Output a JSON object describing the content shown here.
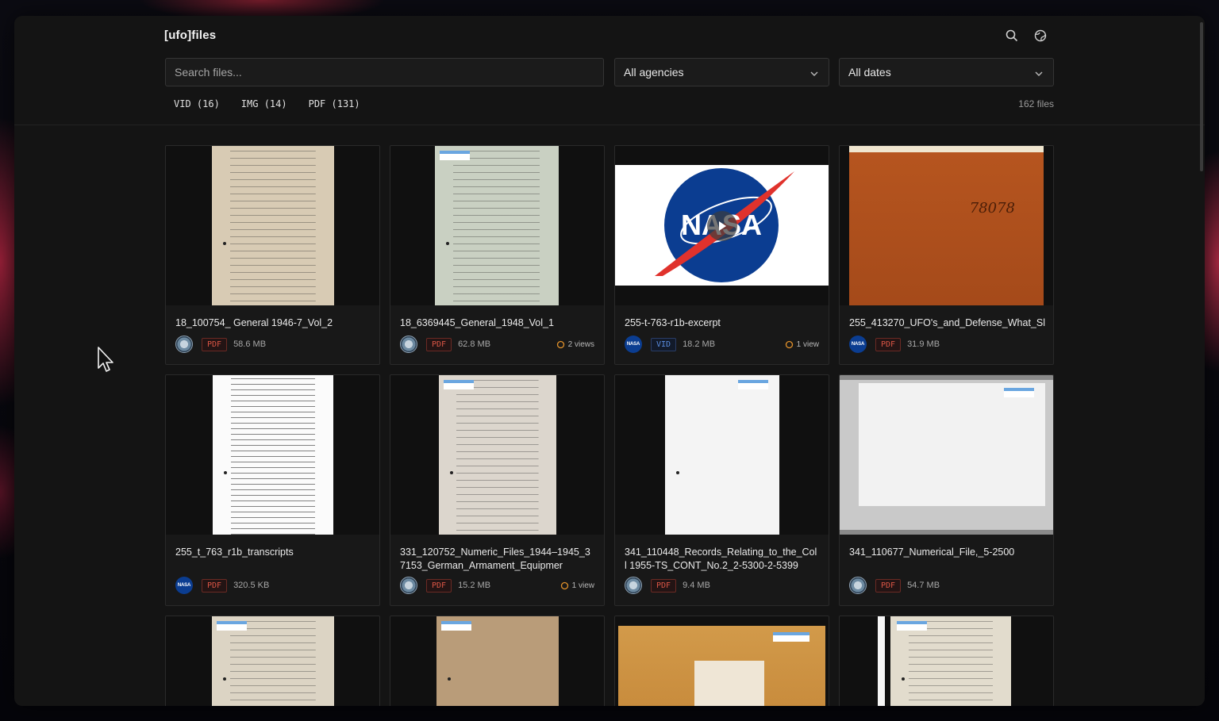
{
  "app": {
    "brand": "[ufo]files"
  },
  "header": {
    "search_placeholder": "Search files...",
    "agency_select": "All agencies",
    "date_select": "All dates",
    "filters": [
      {
        "label": "VID (16)"
      },
      {
        "label": "IMG (14)"
      },
      {
        "label": "PDF (131)"
      }
    ],
    "file_count": "162 files"
  },
  "colors": {
    "accent_pdf": "#d95545",
    "accent_vid": "#5a8de0",
    "background": "#141414"
  },
  "files": [
    {
      "title": "18_100754_ General 1946-7_Vol_2",
      "agency": "seal-icon",
      "type": "PDF",
      "size": "58.6 MB",
      "views": ""
    },
    {
      "title": "18_6369445_General_1948_Vol_1",
      "agency": "seal-icon",
      "type": "PDF",
      "size": "62.8 MB",
      "views": "2 views"
    },
    {
      "title": "255-t-763-r1b-excerpt",
      "agency": "nasa-icon",
      "type": "VID",
      "size": "18.2 MB",
      "views": "1 view"
    },
    {
      "title": "255_413270_UFO's_and_Defense_What_Sl",
      "agency": "nasa-icon",
      "type": "PDF",
      "size": "31.9 MB",
      "views": ""
    },
    {
      "title": "255_t_763_r1b_transcripts",
      "agency": "nasa-icon",
      "type": "PDF",
      "size": "320.5 KB",
      "views": ""
    },
    {
      "title": "331_120752_Numeric_Files_1944–1945_37153_German_Armament_Equipmer",
      "agency": "seal-icon",
      "type": "PDF",
      "size": "15.2 MB",
      "views": "1 view"
    },
    {
      "title": "341_110448_Records_Relating_to_the_Coll 1955-TS_CONT_No.2_2-5300-2-5399",
      "agency": "seal-icon",
      "type": "PDF",
      "size": "9.4 MB",
      "views": ""
    },
    {
      "title": "341_110677_Numerical_File,_5-2500",
      "agency": "seal-icon",
      "type": "PDF",
      "size": "54.7 MB",
      "views": ""
    }
  ],
  "thumbs": {
    "nasa_wordmark": "NASA",
    "folder_number": "78078"
  }
}
